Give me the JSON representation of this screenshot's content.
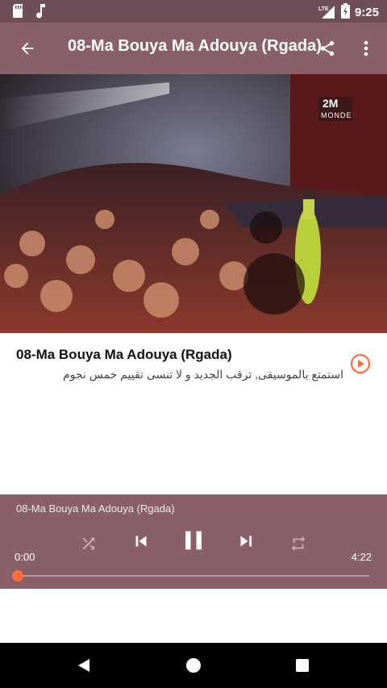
{
  "status_bar": {
    "network": "LTE",
    "time": "9:25"
  },
  "app_bar": {
    "title": "08-Ma Bouya Ma Adouya (Rgada)"
  },
  "video": {
    "channel_logo": "2M",
    "channel_sub": "MONDE"
  },
  "song": {
    "title": "08-Ma Bouya Ma Adouya (Rgada)",
    "description": "استمتع بالموسيقى, ترقب الجديد و لا تنسى تقييم خمس نجوم"
  },
  "player": {
    "track_title": "08-Ma Bouya Ma Adouya (Rgada)",
    "time_current": "0:00",
    "time_total": "4:22",
    "progress": 0.0,
    "state": "playing"
  },
  "colors": {
    "primary": "#8a6068",
    "status": "#6e4f58",
    "accent": "#ff6d3a"
  },
  "icons": [
    "sd-card-icon",
    "music-note-icon",
    "lte-signal-icon",
    "battery-icon",
    "back-arrow-icon",
    "share-icon",
    "more-vert-icon",
    "play-circle-icon",
    "shuffle-icon",
    "skip-previous-icon",
    "pause-icon",
    "skip-next-icon",
    "repeat-icon",
    "nav-back-icon",
    "nav-home-icon",
    "nav-recents-icon"
  ]
}
